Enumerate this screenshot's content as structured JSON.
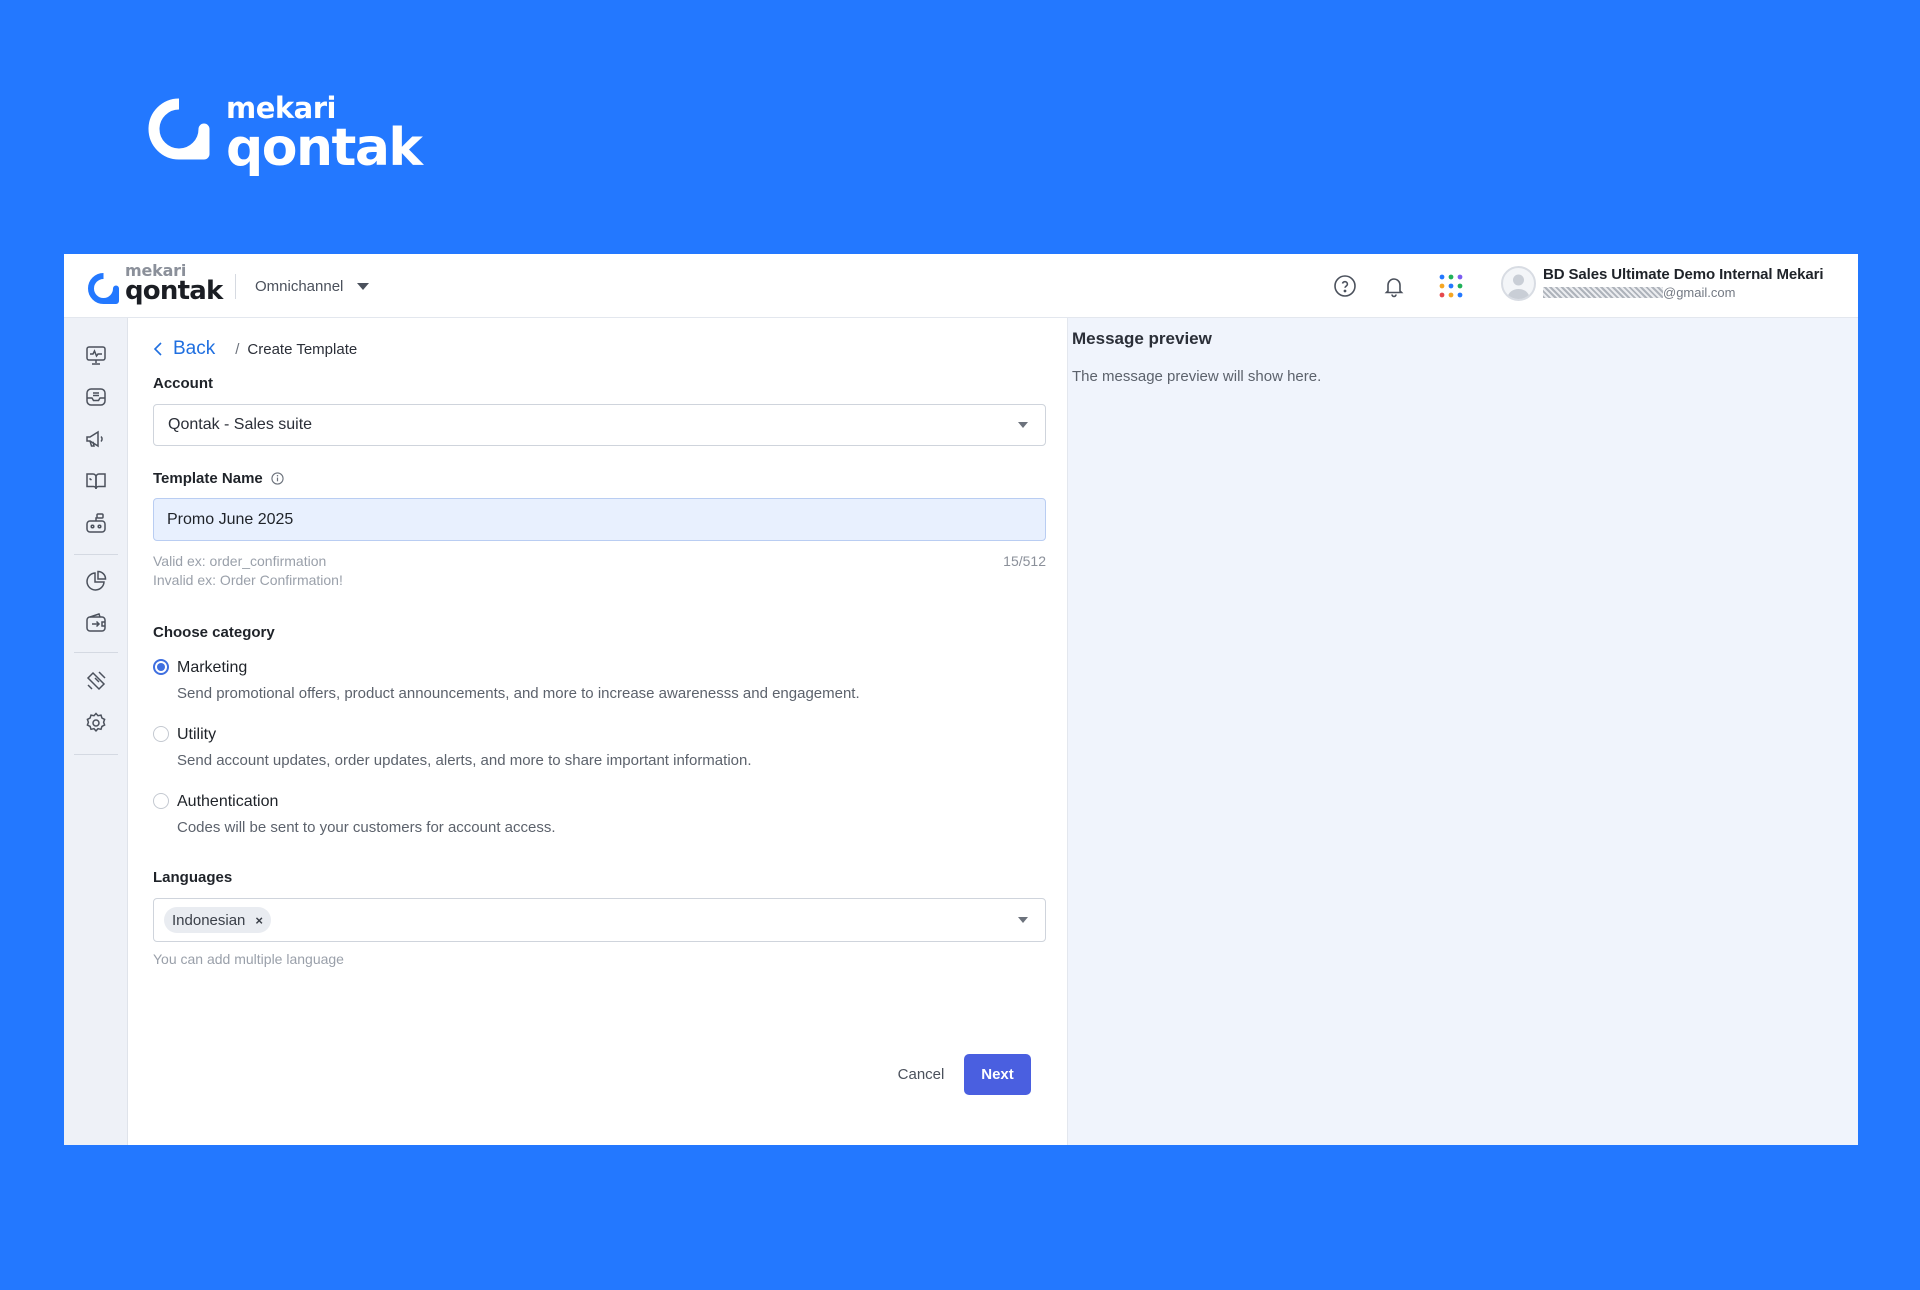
{
  "hero": {
    "brand_top": "mekari",
    "brand_main": "qontak"
  },
  "header": {
    "brand_top": "mekari",
    "brand_main": "qontak",
    "product": "Omnichannel",
    "user_name": "BD Sales Ultimate Demo Internal Mekari",
    "user_email_domain": "@gmail.com"
  },
  "sidebar": {
    "items": [
      "monitor-icon",
      "inbox-icon",
      "megaphone-icon",
      "book-icon",
      "bot-icon",
      "report-pie-icon",
      "wallet-icon",
      "integration-icon",
      "settings-icon"
    ]
  },
  "breadcrumb": {
    "back": "Back",
    "separator": "/",
    "current": "Create Template"
  },
  "form": {
    "account_label": "Account",
    "account_value": "Qontak - Sales suite",
    "template_name_label": "Template Name",
    "template_name_value": "Promo June 2025",
    "hint_valid": "Valid ex: order_confirmation",
    "hint_invalid": "Invalid ex: Order Confirmation!",
    "counter": "15/512",
    "category_label": "Choose category",
    "categories": [
      {
        "title": "Marketing",
        "desc": "Send promotional offers, product announcements, and more to increase awarenesss and engagement.",
        "selected": true
      },
      {
        "title": "Utility",
        "desc": "Send account updates, order updates, alerts, and more to share important information.",
        "selected": false
      },
      {
        "title": "Authentication",
        "desc": "Codes will be sent to your customers for account access.",
        "selected": false
      }
    ],
    "languages_label": "Languages",
    "language_chip": "Indonesian",
    "chip_remove": "×",
    "languages_hint": "You can add multiple language",
    "cancel": "Cancel",
    "next": "Next"
  },
  "preview": {
    "title": "Message preview",
    "empty_text": "The message preview will show here."
  },
  "colors": {
    "brand_blue": "#2378FF",
    "primary_button": "#4A5FE0",
    "link": "#1F6FE0",
    "preview_bg": "#F0F4FC"
  }
}
